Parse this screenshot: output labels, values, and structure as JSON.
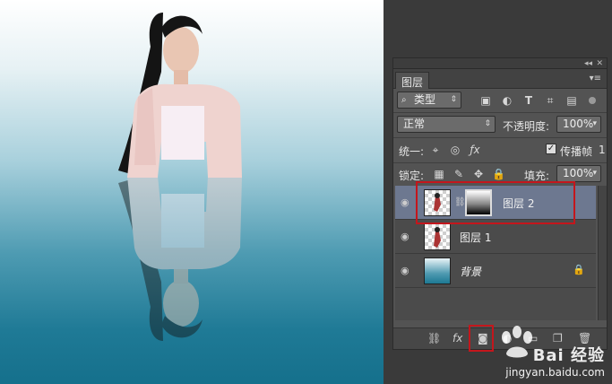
{
  "panel": {
    "tab_label": "图层",
    "filter_select": "类型",
    "blend_mode": "正常",
    "opacity_label": "不透明度:",
    "opacity_value": "100%",
    "unify_label": "统一:",
    "propagate_label": "传播帧",
    "propagate_value": "1",
    "lock_label": "锁定:",
    "fill_label": "填充:",
    "fill_value": "100%"
  },
  "layers": [
    {
      "name": "图层 2",
      "selected": true,
      "has_mask": true
    },
    {
      "name": "图层 1",
      "selected": false,
      "has_mask": false
    },
    {
      "name": "背景",
      "selected": false,
      "locked": true
    }
  ],
  "footer_icons": [
    "link-icon",
    "fx-icon",
    "mask-icon",
    "adjustment-icon",
    "group-icon",
    "new-layer-icon",
    "trash-icon"
  ],
  "watermark": {
    "brand": "Bai 经验",
    "url": "jingyan.baidu.com"
  },
  "colors": {
    "highlight": "#c4161c",
    "selected_layer": "#6d7890",
    "panel_bg": "#535353"
  }
}
